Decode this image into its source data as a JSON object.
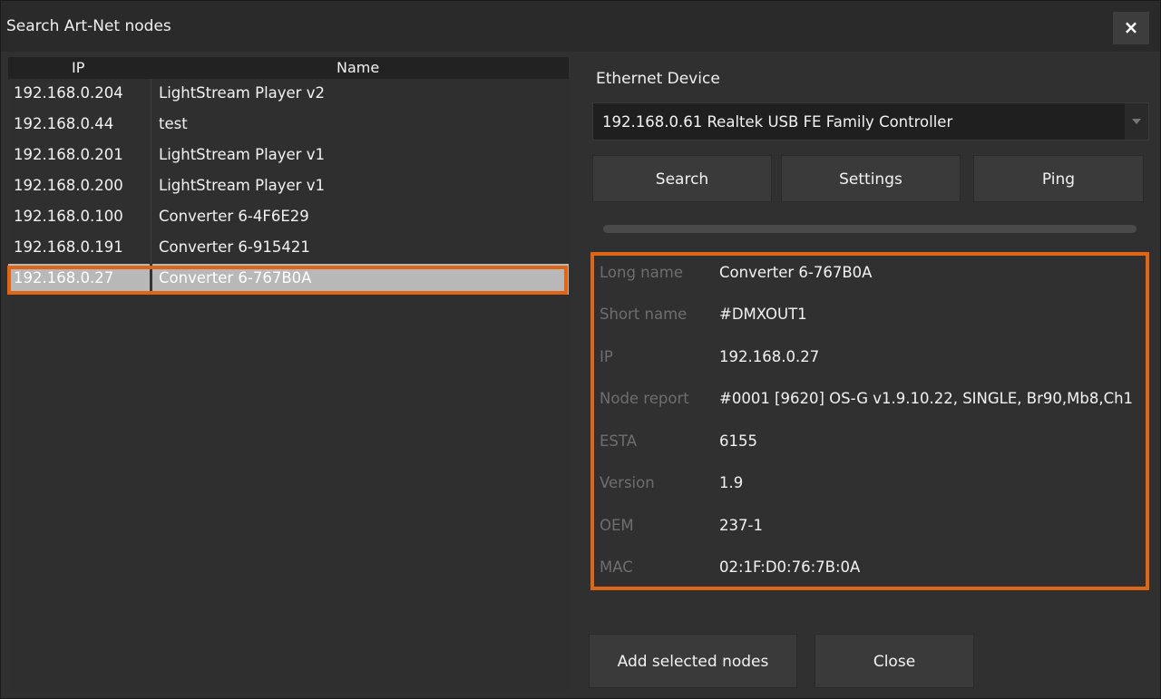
{
  "window": {
    "title": "Search Art-Net nodes",
    "close_glyph": "×"
  },
  "table": {
    "columns": [
      "IP",
      "Name"
    ],
    "rows": [
      {
        "ip": "192.168.0.204",
        "name": "LightStream Player v2"
      },
      {
        "ip": "192.168.0.44",
        "name": "test"
      },
      {
        "ip": "192.168.0.201",
        "name": "LightStream Player v1"
      },
      {
        "ip": "192.168.0.200",
        "name": "LightStream Player v1"
      },
      {
        "ip": "192.168.0.100",
        "name": "Converter 6-4F6E29"
      },
      {
        "ip": "192.168.0.191",
        "name": "Converter 6-915421"
      },
      {
        "ip": "192.168.0.27",
        "name": "Converter 6-767B0A"
      }
    ],
    "selected_index": 6
  },
  "ethernet": {
    "label": "Ethernet Device",
    "selected": "192.168.0.61 Realtek USB FE Family Controller"
  },
  "buttons": {
    "search": "Search",
    "settings": "Settings",
    "ping": "Ping"
  },
  "details": [
    {
      "key": "Long name",
      "value": "Converter 6-767B0A"
    },
    {
      "key": "Short name",
      "value": "#DMXOUT1"
    },
    {
      "key": "IP",
      "value": "192.168.0.27"
    },
    {
      "key": "Node report",
      "value": "#0001 [9620] OS-G v1.9.10.22, SINGLE, Br90,Mb8,Ch1"
    },
    {
      "key": "ESTA",
      "value": "6155"
    },
    {
      "key": "Version",
      "value": "1.9"
    },
    {
      "key": "OEM",
      "value": "237-1"
    },
    {
      "key": "MAC",
      "value": "02:1F:D0:76:7B:0A"
    }
  ],
  "footer": {
    "add_selected": "Add selected nodes",
    "close": "Close"
  },
  "colors": {
    "highlight": "#e06616",
    "selected_row": "#b8b8b8"
  }
}
